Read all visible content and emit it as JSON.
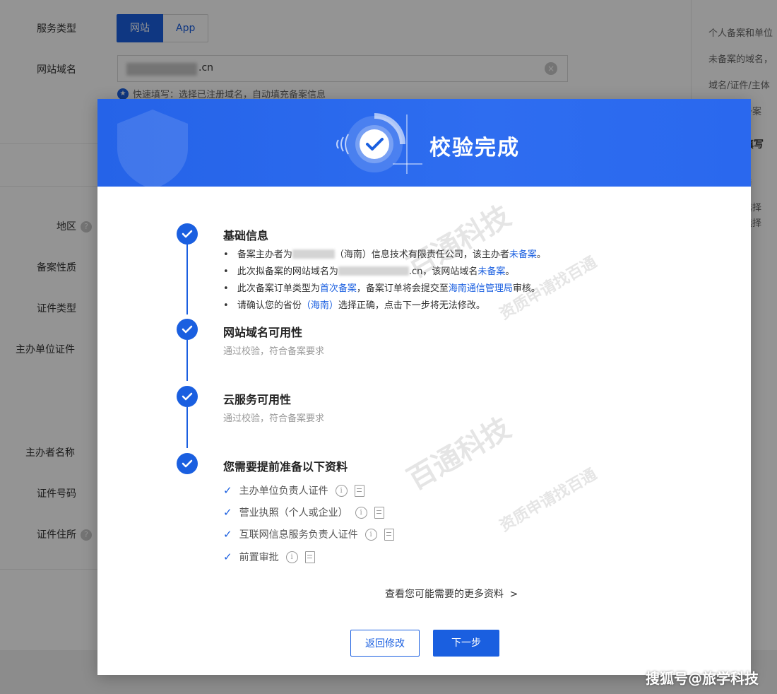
{
  "form": {
    "service_type_label": "服务类型",
    "service_type_options": [
      "网站",
      "App"
    ],
    "domain_label": "网站域名",
    "domain_value": ".cn",
    "quick_fill": "快速填写：选择已注册域名，自动填充备案信息",
    "labels": [
      "地区",
      "备案性质",
      "证件类型",
      "主办单位证件",
      "主办者名称",
      "证件号码",
      "证件住所"
    ]
  },
  "side_panel": {
    "items": [
      "个人备案和单位",
      "未备案的域名，",
      "域名/证件/主体",
      "案备案",
      "案填写",
      "选",
      "请选择",
      "质选择"
    ]
  },
  "modal": {
    "title": "校验完成",
    "steps": [
      {
        "title": "基础信息",
        "bullets": [
          {
            "pre": "备案主办者为",
            "mid": "（海南）信息技术有限责任公司，该主办者",
            "link": "未备案",
            "post": "。"
          },
          {
            "pre": "此次拟备案的网站域名为",
            "mid": ".cn，该网站域名",
            "link": "未备案",
            "post": "。"
          },
          {
            "pre": "此次备案订单类型为",
            "link1": "首次备案",
            "mid": "，备案订单将会提交至",
            "link2": "海南通信管理局",
            "post": "审核。"
          },
          {
            "pre": "请确认您的省份",
            "link": "（海南）",
            "post": "选择正确，点击下一步将无法修改。"
          }
        ]
      },
      {
        "title": "网站域名可用性",
        "subtitle": "通过校验，符合备案要求"
      },
      {
        "title": "云服务可用性",
        "subtitle": "通过校验，符合备案要求"
      },
      {
        "title": "您需要提前准备以下资料",
        "requirements": [
          "主办单位负责人证件",
          "营业执照（个人或企业）",
          "互联网信息服务负责人证件",
          "前置审批"
        ]
      }
    ],
    "more_link": "查看您可能需要的更多资料",
    "back_button": "返回修改",
    "next_button": "下一步"
  },
  "watermark": {
    "brand": "百通科技",
    "slogan": "资质申请找百通"
  },
  "source_mark": "搜狐号@旅学科技",
  "colors": {
    "primary": "#1a5fe0",
    "header_gradient_start": "#2563e8",
    "overlay": "rgba(0,0,0,0.42)"
  }
}
